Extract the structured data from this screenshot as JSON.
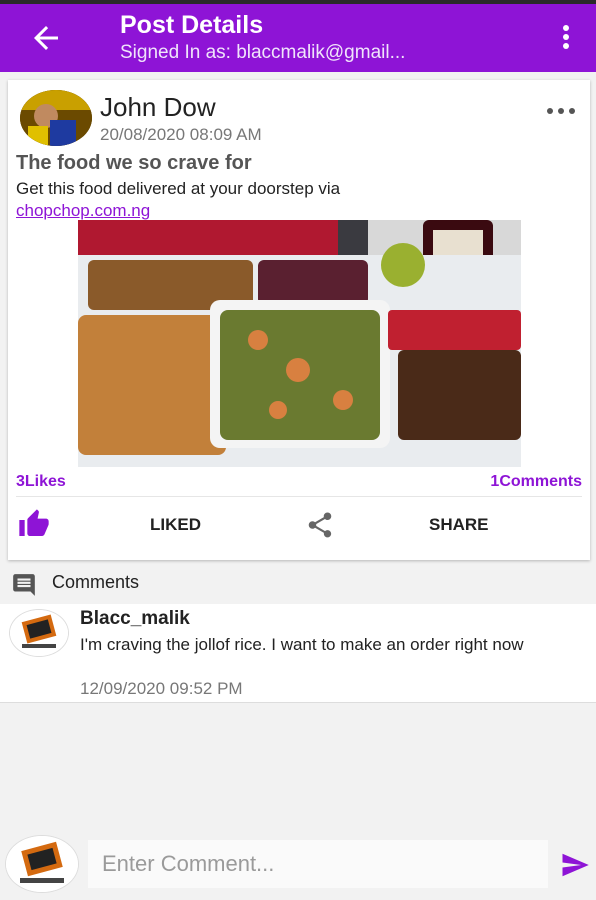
{
  "appbar": {
    "title": "Post Details",
    "subtitle": "Signed In as: blaccmalik@gmail..."
  },
  "post": {
    "author": "John Dow",
    "timestamp": "20/08/2020 08:09 AM",
    "title": "The food we so crave for",
    "body": "Get this food delivered at your doorstep via",
    "link_text": "chopchop.com.ng",
    "likes": "3Likes",
    "comments": "1Comments",
    "liked_label": "LIKED",
    "share_label": "SHARE",
    "image_subject": "food-platter-photo"
  },
  "comments_section": {
    "header": "Comments",
    "items": [
      {
        "author": "Blacc_malik",
        "text": "I'm craving the jollof rice. I want to make an order right now",
        "timestamp": "12/09/2020 09:52 PM"
      }
    ]
  },
  "composer": {
    "placeholder": "Enter Comment..."
  },
  "icons": {
    "back": "arrow-left-icon",
    "overflow": "more-vert-icon",
    "post_menu": "more-horiz-icon",
    "like": "thumbs-up-icon",
    "share": "share-icon",
    "comments": "comment-icon",
    "send": "send-icon"
  },
  "colors": {
    "primary": "#8e14d6",
    "background": "#f2f2f2"
  }
}
